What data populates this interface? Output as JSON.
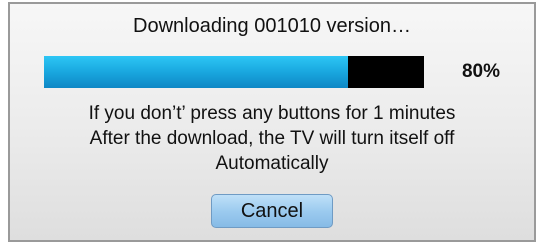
{
  "dialog": {
    "title": "Downloading 001010 version…",
    "progress": {
      "value": 0.8,
      "label": "80%",
      "fill_color": "#19a7df",
      "track_color": "#000000"
    },
    "message_lines": [
      "If you don’t’ press any buttons for 1 minutes",
      "After the download, the TV will turn itself off",
      "Automatically"
    ],
    "cancel_label": "Cancel"
  }
}
